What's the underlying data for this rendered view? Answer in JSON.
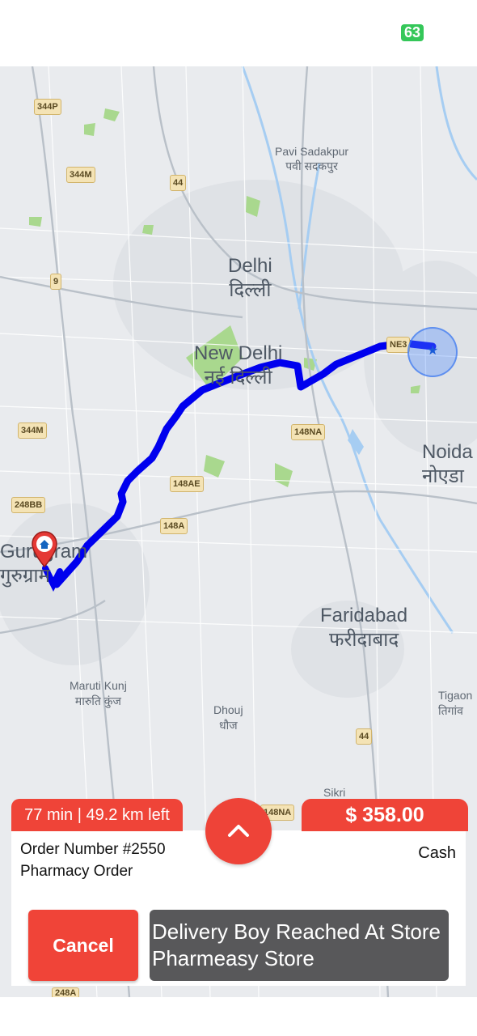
{
  "status_bar": {
    "battery": "63"
  },
  "map": {
    "cities": [
      {
        "name_en": "Pavi Sadakpur",
        "name_hi": "पवी सदकपुर"
      },
      {
        "name_en": "Delhi",
        "name_hi": "दिल्ली"
      },
      {
        "name_en": "New Delhi",
        "name_hi": "नई दिल्ली"
      },
      {
        "name_en": "Noida",
        "name_hi": "नोएडा"
      },
      {
        "name_en": "Gurugram",
        "name_hi": "गुरुग्राम"
      },
      {
        "name_en": "Faridabad",
        "name_hi": "फरीदाबाद"
      },
      {
        "name_en": "Maruti Kunj",
        "name_hi": "मारुति कुंज"
      },
      {
        "name_en": "Dhouj",
        "name_hi": "धौज"
      },
      {
        "name_en": "Tigaon",
        "name_hi": "तिगांव"
      },
      {
        "name_en": "Sikri",
        "name_hi": ""
      }
    ],
    "road_shields": [
      "344P",
      "344M",
      "44",
      "9",
      "NE3",
      "344M",
      "148NA",
      "248BB",
      "148AE",
      "148A",
      "44",
      "148NA",
      "248A"
    ],
    "route_color": "#0000ee",
    "destination_icon": "home-pin-icon",
    "current_location_icon": "location-dot-icon"
  },
  "order": {
    "eta": "77 min | 49.2 km left",
    "price": "$ 358.00",
    "number": "Order Number #2550",
    "type": "Pharmacy Order",
    "payment": "Cash"
  },
  "actions": {
    "cancel": "Cancel",
    "status": "Delivery Boy Reached At Store Pharmeasy Store"
  },
  "colors": {
    "accent": "#ef4438",
    "status_button": "#58585a",
    "route": "#0000ee"
  }
}
